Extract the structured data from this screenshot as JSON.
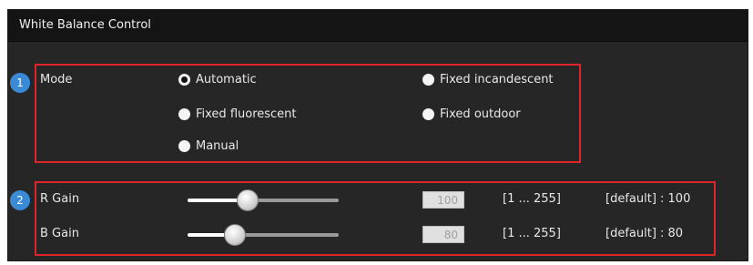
{
  "panel_title": "White Balance Control",
  "sections": {
    "s1_number": "1",
    "s2_number": "2"
  },
  "mode": {
    "label": "Mode",
    "options": {
      "automatic": "Automatic",
      "fixed_incandescent": "Fixed incandescent",
      "fixed_fluorescent": "Fixed fluorescent",
      "fixed_outdoor": "Fixed outdoor",
      "manual": "Manual"
    },
    "selected": "automatic"
  },
  "gains": {
    "r": {
      "label": "R Gain",
      "value": "100",
      "range": "[1 ... 255]",
      "default_text": "[default] : 100"
    },
    "b": {
      "label": "B Gain",
      "value": "80",
      "range": "[1 ... 255]",
      "default_text": "[default] : 80"
    }
  },
  "colors": {
    "highlight_border": "#e1232b",
    "badge": "#3a8ad6"
  }
}
